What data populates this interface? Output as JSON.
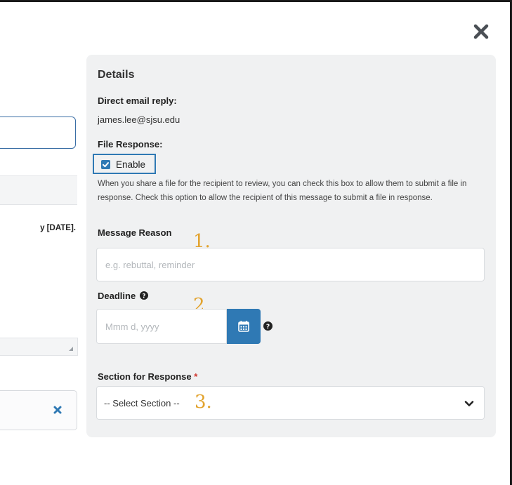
{
  "left_page": {
    "visible_text": "y [DATE]."
  },
  "details": {
    "title": "Details",
    "direct_email_label": "Direct email reply:",
    "direct_email_value": "james.lee@sjsu.edu",
    "file_response_label": "File Response:",
    "enable_label": "Enable",
    "enable_checked": true,
    "help_text": "When you share a file for the recipient to review, you can check this box to allow them to submit a file in response. Check this option to allow the recipient of this message to submit a file in response.",
    "message_reason_label": "Message Reason",
    "message_reason_placeholder": "e.g. rebuttal, reminder",
    "deadline_label": "Deadline",
    "deadline_placeholder": "Mmm d, yyyy",
    "section_label": "Section for Response",
    "required_marker": "*",
    "section_selected": "-- Select Section --"
  },
  "annotations": [
    "1.",
    "2.",
    "3."
  ],
  "colors": {
    "accent": "#2f79b4",
    "panel_bg": "#f0f1f2",
    "annotation": "#e2a32e",
    "required": "#d0342c"
  },
  "icons": [
    "close-icon",
    "checkbox-checked-icon",
    "help-circle-icon",
    "calendar-icon",
    "chevron-down-icon"
  ]
}
